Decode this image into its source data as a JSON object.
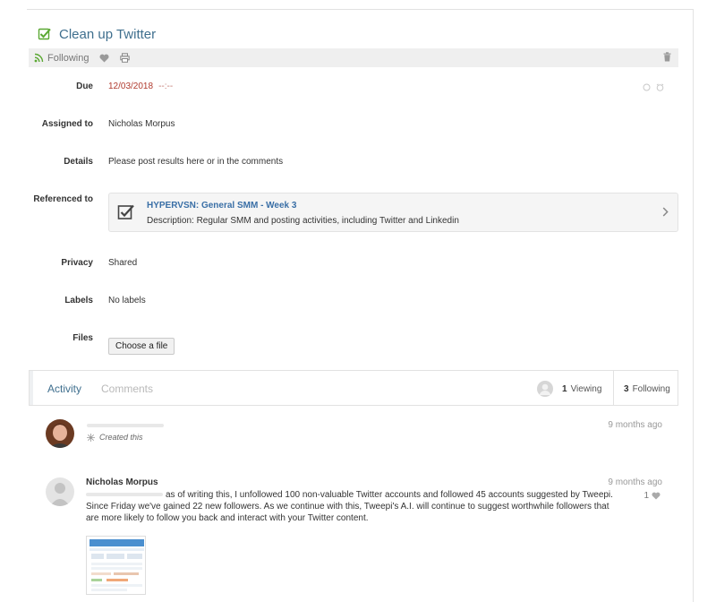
{
  "task": {
    "title": "Clean up Twitter",
    "completed": true
  },
  "toolbar": {
    "following_label": "Following"
  },
  "fields": {
    "due_label": "Due",
    "due_date": "12/03/2018",
    "due_time": "--:--",
    "assigned_label": "Assigned to",
    "assigned_value": "Nicholas Morpus",
    "details_label": "Details",
    "details_value": "Please post results here or in the comments",
    "referenced_label": "Referenced to",
    "privacy_label": "Privacy",
    "privacy_value": "Shared",
    "labels_label": "Labels",
    "labels_value": "No labels",
    "files_label": "Files",
    "files_button": "Choose a file"
  },
  "reference": {
    "title": "HYPERVSN: General SMM - Week 3",
    "description": "Description: Regular SMM and posting activities, including Twitter and Linkedin"
  },
  "activity": {
    "tab_activity": "Activity",
    "tab_comments": "Comments",
    "viewing_count": "1",
    "viewing_label": "Viewing",
    "following_count": "3",
    "following_label": "Following"
  },
  "feed": [
    {
      "action": "Created this",
      "time": "9 months ago"
    },
    {
      "author": "Nicholas Morpus",
      "time": "9 months ago",
      "text": "as of writing this, I unfollowed 100 non-valuable Twitter accounts and followed 45 accounts suggested by Tweepi. Since Friday we've gained 22 new followers. As we continue with this, Tweepi's A.I. will continue to suggest worthwhile followers that are more likely to follow you back and interact with your Twitter content.",
      "likes": "1"
    }
  ],
  "icons": {
    "check": "check-square-icon",
    "rss": "rss-icon",
    "heart": "heart-icon",
    "print": "print-icon",
    "trash": "trash-icon",
    "chevron": "chevron-right-icon",
    "user": "user-avatar-icon",
    "sparkle": "sparkle-icon"
  },
  "colors": {
    "accent": "#3f6f8e",
    "link": "#3a6fa6",
    "check_green": "#5aa832",
    "due_red": "#b03a2e"
  }
}
